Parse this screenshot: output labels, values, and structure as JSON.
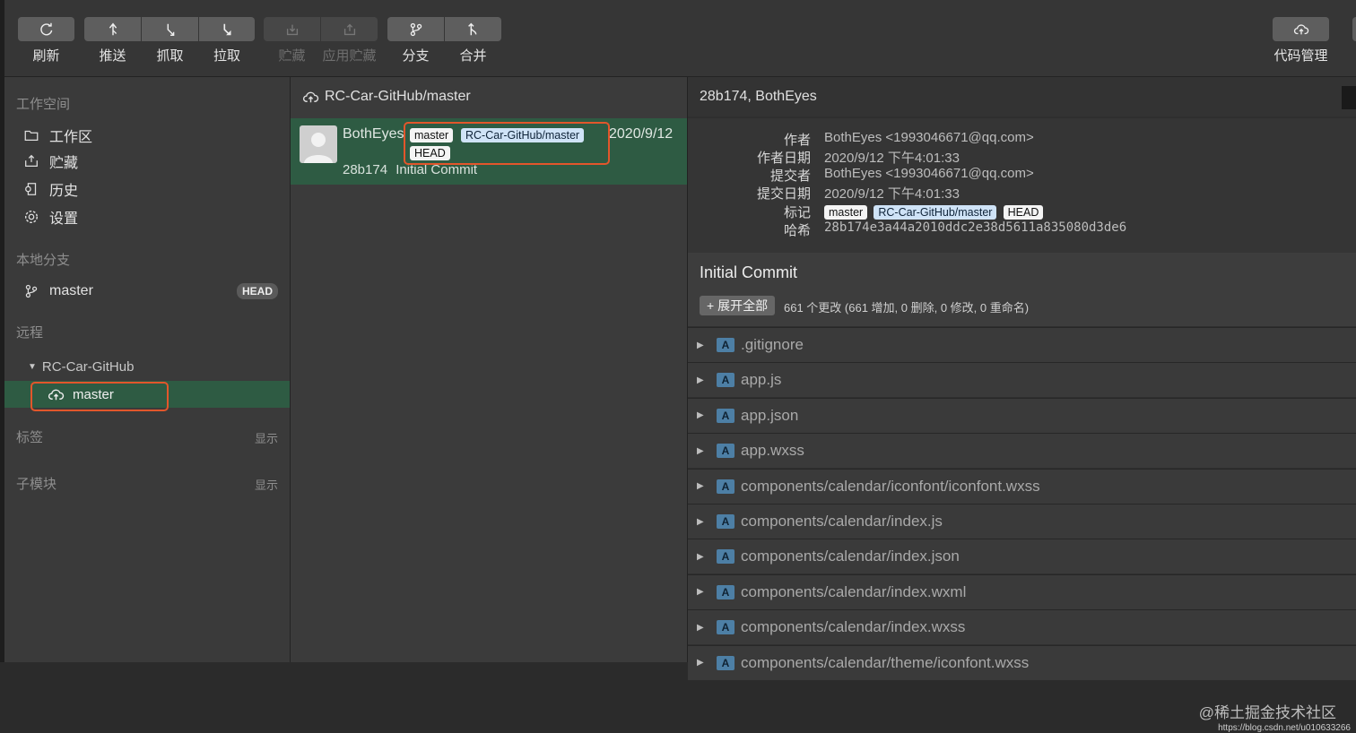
{
  "toolbar": {
    "buttons": [
      {
        "id": "refresh",
        "label": "刷新",
        "icon": "refresh-icon",
        "enabled": true
      },
      {
        "id": "push",
        "label": "推送",
        "icon": "push-icon",
        "enabled": true
      },
      {
        "id": "fetch",
        "label": "抓取",
        "icon": "fetch-icon",
        "enabled": true
      },
      {
        "id": "pull",
        "label": "拉取",
        "icon": "pull-icon",
        "enabled": true
      },
      {
        "id": "stash",
        "label": "贮藏",
        "icon": "stash-icon",
        "enabled": false
      },
      {
        "id": "apply-stash",
        "label": "应用贮藏",
        "icon": "apply-stash-icon",
        "enabled": false
      },
      {
        "id": "branch",
        "label": "分支",
        "icon": "branch-icon",
        "enabled": true
      },
      {
        "id": "merge",
        "label": "合并",
        "icon": "merge-icon",
        "enabled": true
      }
    ],
    "right_button": {
      "label": "代码管理",
      "icon": "cloud-icon"
    }
  },
  "sidebar": {
    "workspace_title": "工作空间",
    "workspace_items": [
      {
        "label": "工作区",
        "icon": "folder-icon"
      },
      {
        "label": "贮藏",
        "icon": "stash-tray-icon"
      },
      {
        "label": "历史",
        "icon": "history-icon"
      },
      {
        "label": "设置",
        "icon": "gear-icon"
      }
    ],
    "local_title": "本地分支",
    "local_branch": {
      "label": "master",
      "badge": "HEAD",
      "icon": "branch-icon"
    },
    "remote_title": "远程",
    "remote_name": "RC-Car-GitHub",
    "remote_branch": {
      "label": "master",
      "icon": "cloud-icon"
    },
    "tags_title": "标签",
    "tags_action": "显示",
    "submodules_title": "子模块",
    "submodules_action": "显示"
  },
  "history": {
    "header": "RC-Car-GitHub/master",
    "commit": {
      "author": "BothEyes",
      "refs": [
        "master",
        "RC-Car-GitHub/master",
        "HEAD"
      ],
      "date": "2020/9/12",
      "hash": "28b174",
      "message": "Initial Commit"
    }
  },
  "details": {
    "header_hash": "28b174",
    "header_author": "BothEyes",
    "header_separator": ", ",
    "meta": {
      "author_label": "作者",
      "author_value": "BothEyes <1993046671@qq.com>",
      "author_date_label": "作者日期",
      "author_date_value": "2020/9/12 下午4:01:33",
      "committer_label": "提交者",
      "committer_value": "BothEyes <1993046671@qq.com>",
      "commit_date_label": "提交日期",
      "commit_date_value": "2020/9/12 下午4:01:33",
      "tags_label": "标记",
      "hash_label": "哈希",
      "hash_value": "28b174e3a44a2010ddc2e38d5611a835080d3de6"
    },
    "commit_title": "Initial Commit",
    "expand_label": "+ 展开全部",
    "change_summary": "661 个更改 (661 增加, 0 删除, 0 修改, 0 重命名)",
    "files": [
      ".gitignore",
      "app.js",
      "app.json",
      "app.wxss",
      "components/calendar/iconfont/iconfont.wxss",
      "components/calendar/index.js",
      "components/calendar/index.json",
      "components/calendar/index.wxml",
      "components/calendar/index.wxss",
      "components/calendar/theme/iconfont.wxss"
    ],
    "file_status": "A"
  },
  "watermark": "@稀土掘金技术社区",
  "watermark_url": "https://blog.csdn.net/u010633266"
}
